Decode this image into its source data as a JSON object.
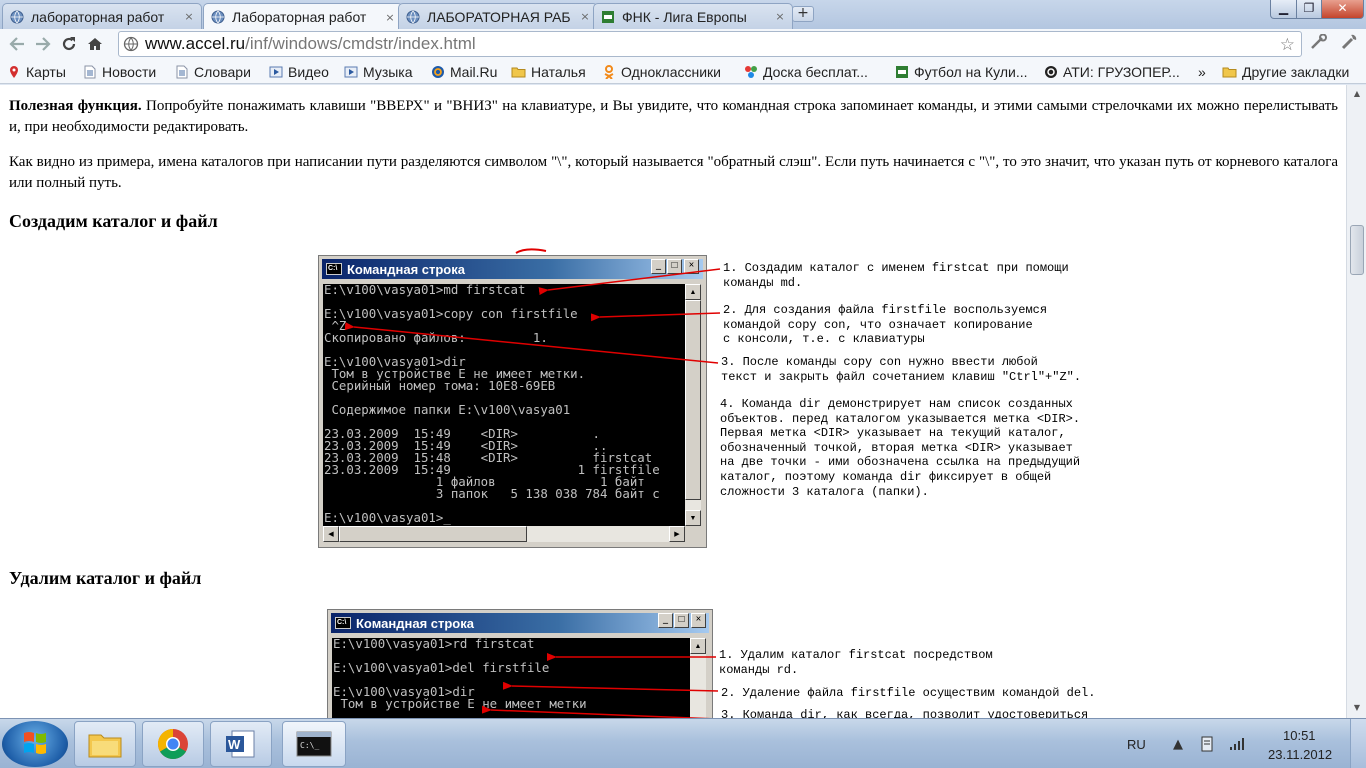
{
  "browser": {
    "tabs": [
      {
        "title": "лабораторная работ",
        "close": "×",
        "icon": "globe-icon"
      },
      {
        "title": "Лабораторная работ",
        "close": "×",
        "icon": "globe-icon",
        "active": true
      },
      {
        "title": "ЛАБОРАТОРНАЯ РАБ",
        "close": "×",
        "icon": "globe-icon"
      },
      {
        "title": "ФНК - Лига Европы",
        "close": "×",
        "icon": "fnk-icon"
      }
    ],
    "new_tab": "+",
    "window_controls": {
      "minimize": "▁",
      "maximize": "❐",
      "close": "✕"
    },
    "url_host": "www.accel.ru",
    "url_path": "/inf/windows/cmdstr/index.html",
    "bookmarks": [
      {
        "label": "Карты",
        "icon": "maps-icon"
      },
      {
        "label": "Новости",
        "icon": "page-icon"
      },
      {
        "label": "Словари",
        "icon": "page-icon"
      },
      {
        "label": "Видео",
        "icon": "video-icon"
      },
      {
        "label": "Музыка",
        "icon": "music-icon"
      },
      {
        "label": "Mail.Ru",
        "icon": "mail-icon"
      },
      {
        "label": "Наталья",
        "icon": "folder-icon"
      },
      {
        "label": "Одноклассники",
        "icon": "ok-icon"
      },
      {
        "label": "Доска бесплат...",
        "icon": "board-icon"
      },
      {
        "label": "Футбол на Кули...",
        "icon": "fnk-icon"
      },
      {
        "label": "АТИ: ГРУЗОПЕР...",
        "icon": "ati-icon"
      },
      {
        "label": "»",
        "icon": ""
      },
      {
        "label": "Другие закладки",
        "icon": "folder-icon"
      }
    ]
  },
  "content": {
    "para1_bold": "Полезная функция.",
    "para1_text": " Попробуйте понажимать клавиши \"ВВЕРХ\" и \"ВНИЗ\" на клавиатуре, и Вы увидите, что командная строка запоминает команды, и этими самыми стрелочками их можно перелистывать и, при необходимости редактировать.",
    "para2": "Как видно из примера, имена каталогов при написании пути разделяются символом \"\\\", который называется \"обратный слэш\". Если путь начинается с \"\\\", то это значит, что указан путь от корневого каталога или полный путь.",
    "heading1": "Создадим каталог и файл",
    "heading2": "Удалим каталог и файл",
    "cmd_title": "Командная строка",
    "cmd_icon_text": "C:\\",
    "console1": "E:\\v100\\vasya01>md firstcat\n\nE:\\v100\\vasya01>copy con firstfile\n ^Z\nСкопировано файлов:         1.\n\nE:\\v100\\vasya01>dir\n Том в устройстве E не имеет метки.\n Серийный номер тома: 10E8-69EB\n\n Содержимое папки E:\\v100\\vasya01\n\n23.03.2009  15:49    <DIR>          .\n23.03.2009  15:49    <DIR>          ..\n23.03.2009  15:48    <DIR>          firstcat\n23.03.2009  15:49                 1 firstfile\n               1 файлов              1 байт\n               3 папок   5 138 038 784 байт с\n\nE:\\v100\\vasya01>_",
    "console2": "E:\\v100\\vasya01>rd firstcat\n\nE:\\v100\\vasya01>del firstfile\n\nE:\\v100\\vasya01>dir\n Том в устройстве E не имеет метки",
    "notes1": [
      "1. Создадим каталог с именем firstcat при помощи\nкоманды md.",
      "2. Для создания файла firstfile воспользуемся\nкомандой copy con, что означает копирование\nс консоли, т.е. с клавиатуры",
      "3. После команды copy con нужно ввести любой\nтекст и закрыть файл сочетанием клавиш \"Ctrl\"+\"Z\".",
      "4. Команда dir демонстрирует нам список созданных\nобъектов. перед каталогом указывается метка <DIR>.\nПервая метка <DIR> указывает на текущий каталог,\nобозначенный точкой, вторая метка <DIR> указывает\nна две точки - ими обозначена ссылка на предыдущий\nкаталог, поэтому команда dir фиксирует в общей\nсложности 3 каталога (папки)."
    ],
    "notes2": [
      "1. Удалим каталог firstcat посредством\nкоманды rd.",
      "2. Удаление файла firstfile осуществим командой del.",
      "3. Команда dir, как всегда, позволит удостовериться"
    ]
  },
  "taskbar": {
    "apps": [
      "explorer-icon",
      "chrome-icon",
      "word-icon",
      "cmd-icon"
    ],
    "lang": "RU",
    "time": "10:51",
    "date": "23.11.2012"
  },
  "colors": {
    "arrow": "#e00000",
    "console_bg": "#000000",
    "console_fg": "#c0c0c0",
    "titlebar": "#0a246a"
  }
}
